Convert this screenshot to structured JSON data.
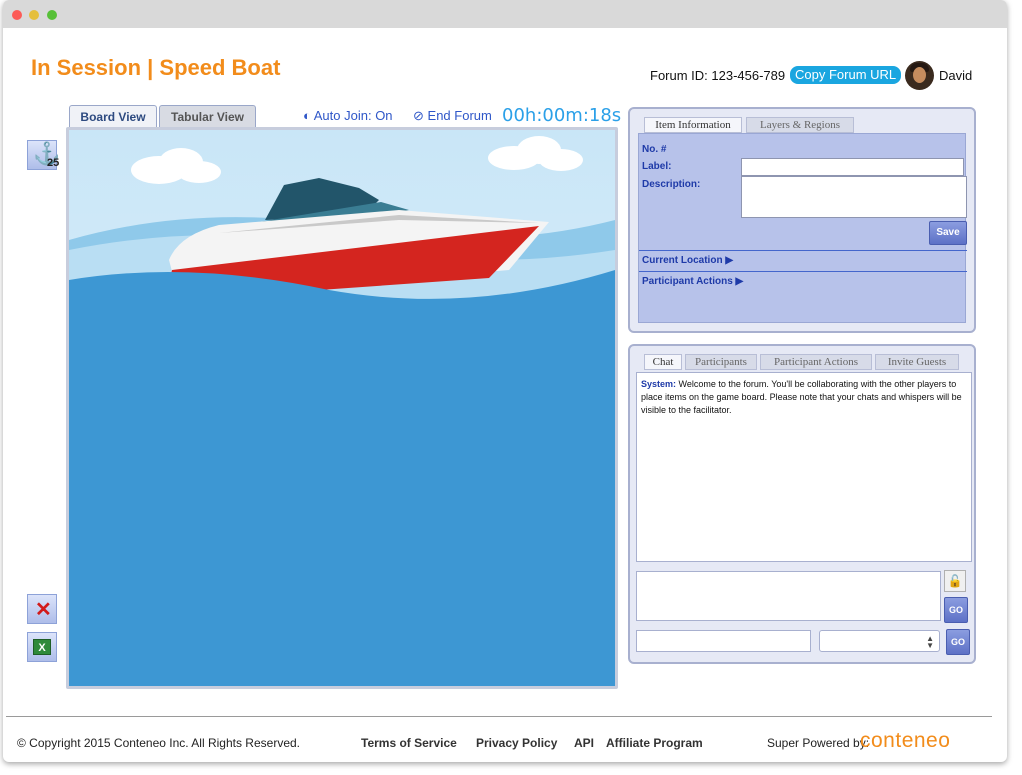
{
  "header": {
    "title": "In Session | Speed Boat",
    "forum_id": "Forum ID: 123-456-789",
    "copy_url_label": "Copy Forum URL",
    "user_name": "David"
  },
  "board": {
    "tabs": [
      "Board View",
      "Tabular View"
    ],
    "auto_join": "Auto Join: On",
    "end_forum": "End Forum",
    "timer": "00h:00m:18s",
    "anchor_count": "25"
  },
  "item_info": {
    "tabs": [
      "Item Information",
      "Layers & Regions"
    ],
    "number_label": "No. #",
    "label_label": "Label:",
    "description_label": "Description:",
    "save_label": "Save",
    "current_location": "Current Location",
    "participant_actions": "Participant Actions"
  },
  "chat": {
    "tabs": [
      "Chat",
      "Participants",
      "Participant Actions",
      "Invite Guests"
    ],
    "system_label": "System:",
    "system_message": "Welcome to the forum. You'll be collaborating with the other players to place items on the game board. Please note that your chats and whispers will be visible to the facilitator.",
    "go_label": "GO"
  },
  "footer": {
    "copyright": "© Copyright 2015 Conteneo Inc. All Rights Reserved.",
    "links": [
      "Terms of Service",
      "Privacy Policy",
      "API",
      "Affiliate Program"
    ],
    "powered_by": "Super Powered by:",
    "brand": "conteneo"
  },
  "colors": {
    "accent": "#f28c1b",
    "link_blue": "#2f57c8",
    "timer": "#2ba0e8",
    "water": "#3d97d3"
  }
}
